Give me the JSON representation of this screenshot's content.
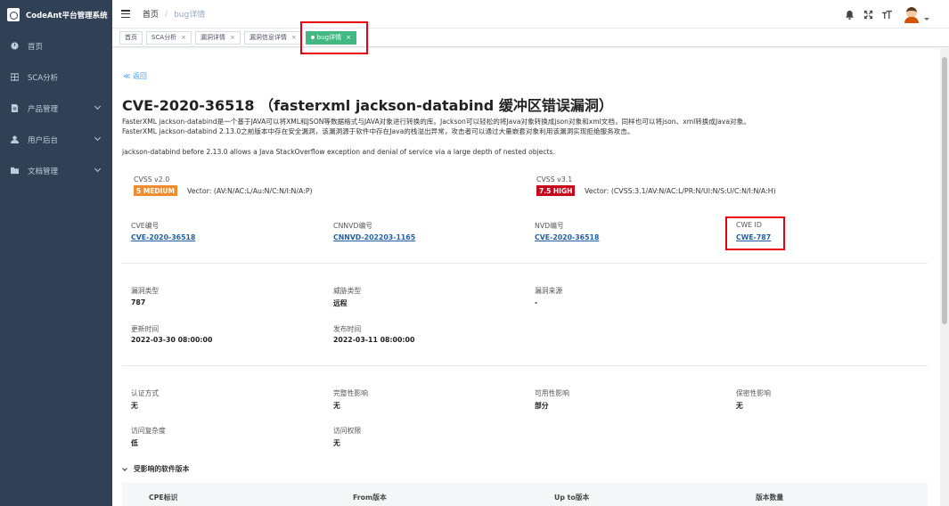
{
  "app": {
    "title": "CodeAnt平台管理系统"
  },
  "sidebar": {
    "items": [
      {
        "label": "首页",
        "icon": "dashboard-icon"
      },
      {
        "label": "SCA分析",
        "icon": "grid-icon"
      },
      {
        "label": "产品管理",
        "icon": "document-icon"
      },
      {
        "label": "用户后台",
        "icon": "user-icon"
      },
      {
        "label": "文档管理",
        "icon": "folder-icon"
      }
    ]
  },
  "header": {
    "breadcrumb": {
      "home": "首页",
      "separator": "/",
      "current": "bug详情"
    },
    "icons": [
      "bell-icon",
      "fullscreen-icon",
      "font-size-icon",
      "avatar"
    ]
  },
  "tags": [
    {
      "label": "首页",
      "closable": false
    },
    {
      "label": "SCA分析",
      "closable": true
    },
    {
      "label": "漏洞详情",
      "closable": true
    },
    {
      "label": "漏洞信息详情",
      "closable": true
    },
    {
      "label": "bug详情",
      "closable": true,
      "active": true
    }
  ],
  "detail": {
    "back": "≪ 返回",
    "title": "CVE-2020-36518 （fasterxml jackson-databind 缓冲区错误漏洞）",
    "desc_line1": "FasterXML jackson-databind是一个基于JAVA可以将XML和JSON等数据格式与JAVA对象进行转换的库。Jackson可以轻松的将Java对象转换成json对象和xml文档，同样也可以将json、xml转换成Java对象。",
    "desc_line2": "FasterXML jackson-databind 2.13.0之前版本中存在安全漏洞，该漏洞源于软件中存在Java的栈溢出异常，攻击者可以通过大量嵌套对象利用该漏洞实现拒绝服务攻击。",
    "desc_en": "jackson-databind before 2.13.0 allows a Java StackOverflow exception and denial of service via a large depth of nested objects.",
    "cvss2": {
      "label": "CVSS v2.0",
      "badge": "5 MEDIUM",
      "badge_color": "#f08c2e",
      "vector": "Vector: (AV:N/AC:L/Au:N/C:N/I:N/A:P)"
    },
    "cvss3": {
      "label": "CVSS v3.1",
      "badge": "7.5 HIGH",
      "badge_color": "#c9071b",
      "vector": "Vector: (CVSS:3.1/AV:N/AC:L/PR:N/UI:N/S:U/C:N/I:N/A:H)"
    },
    "ids": [
      {
        "label": "CVE编号",
        "value": "CVE-2020-36518"
      },
      {
        "label": "CNNVD编号",
        "value": "CNNVD-202203-1165"
      },
      {
        "label": "NVD编号",
        "value": "CVE-2020-36518"
      },
      {
        "label": "CWE ID",
        "value": "CWE-787"
      }
    ],
    "info": [
      {
        "label": "漏洞类型",
        "value": "787"
      },
      {
        "label": "威胁类型",
        "value": "远程"
      },
      {
        "label": "漏洞来源",
        "value": "-"
      },
      {
        "label": "更新时间",
        "value": "2022-03-30 08:00:00"
      },
      {
        "label": "发布时间",
        "value": "2022-03-11 08:00:00"
      }
    ],
    "impact": [
      {
        "label": "认证方式",
        "value": "无"
      },
      {
        "label": "完整性影响",
        "value": "无"
      },
      {
        "label": "可用性影响",
        "value": "部分"
      },
      {
        "label": "保密性影响",
        "value": "无"
      },
      {
        "label": "访问复杂度",
        "value": "低"
      },
      {
        "label": "访问权限",
        "value": "无"
      }
    ],
    "affected": {
      "title": "受影响的软件版本",
      "columns": [
        "CPE标识",
        "From版本",
        "Up to版本",
        "版本数量"
      ]
    }
  }
}
